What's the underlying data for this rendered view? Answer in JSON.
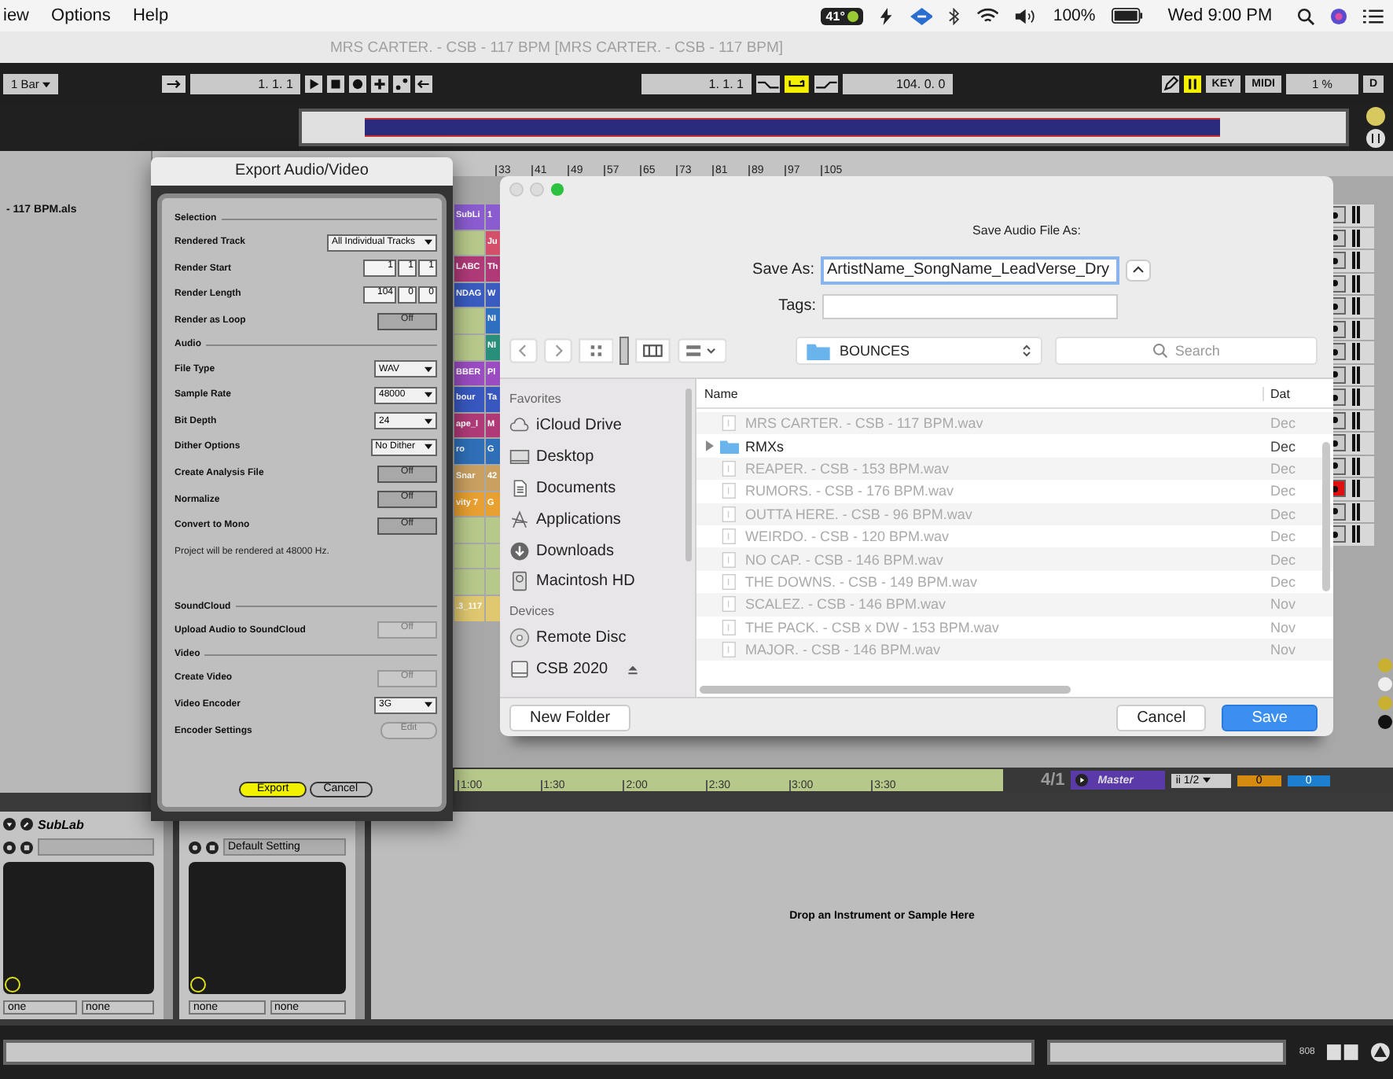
{
  "menu_bar": {
    "items": [
      "iew",
      "Options",
      "Help"
    ],
    "temperature": "41°",
    "battery": "100%",
    "clock": "Wed 9:00 PM"
  },
  "daw": {
    "title": "MRS CARTER. - CSB - 117 BPM  [MRS CARTER. - CSB - 117 BPM]",
    "quantize": "1 Bar",
    "position": "1.   1.   1",
    "loop_start": "1.   1.   1",
    "loop_switch": {
      "on": true
    },
    "loop_length": "104.   0.   0",
    "key_button": "KEY",
    "midi_button": "MIDI",
    "cpu": "1 %",
    "d_button": "D",
    "ruler": [
      "33",
      "41",
      "49",
      "57",
      "65",
      "73",
      "81",
      "89",
      "97",
      "105"
    ],
    "set_name": "- 117 BPM.als",
    "clip_rows": [
      {
        "clips": [
          {
            "label": "SubLi",
            "color": "#8a5cd0"
          },
          {
            "label": "1",
            "color": "#8a5cd0"
          }
        ]
      },
      {
        "clips": [
          {
            "color": "#b7c98a"
          },
          {
            "label": "Ju",
            "color": "#d4506a"
          }
        ]
      },
      {
        "clips": [
          {
            "label": "LABC",
            "color": "#b03a78"
          },
          {
            "label": "Th",
            "color": "#b03a78"
          }
        ]
      },
      {
        "clips": [
          {
            "label": "NDAG",
            "color": "#3a5cc0"
          },
          {
            "label": "W",
            "color": "#3a5cc0"
          }
        ]
      },
      {
        "clips": [
          {
            "color": "#b7c98a"
          },
          {
            "label": "NI",
            "color": "#2f6fc0"
          }
        ]
      },
      {
        "clips": [
          {
            "color": "#b7c98a"
          },
          {
            "label": "NI",
            "color": "#2a8f7a"
          }
        ]
      },
      {
        "clips": [
          {
            "label": "BBER",
            "color": "#9a4cc0"
          },
          {
            "label": "Pl",
            "color": "#9a4cc0"
          }
        ]
      },
      {
        "clips": [
          {
            "label": "bour",
            "color": "#3858c0"
          },
          {
            "label": "Ta",
            "color": "#3858c0"
          }
        ]
      },
      {
        "clips": [
          {
            "label": "ape_l",
            "color": "#b03a78"
          },
          {
            "label": "M",
            "color": "#b03a78"
          }
        ]
      },
      {
        "clips": [
          {
            "label": "ro",
            "color": "#2f6fb8"
          },
          {
            "label": "G",
            "color": "#2f6fb8"
          }
        ]
      },
      {
        "clips": [
          {
            "label": "Snar",
            "color": "#c9a060"
          },
          {
            "label": "42",
            "color": "#c9a060"
          }
        ]
      },
      {
        "clips": [
          {
            "label": "vity 7",
            "color": "#e8a030"
          },
          {
            "label": "G",
            "color": "#e8a030"
          }
        ]
      },
      {
        "clips": [
          {
            "color": "#b7c98a"
          },
          {
            "color": "#b7c98a"
          }
        ]
      },
      {
        "clips": [
          {
            "color": "#b7c98a"
          },
          {
            "color": "#b7c98a"
          }
        ]
      },
      {
        "clips": [
          {
            "color": "#b7c98a"
          },
          {
            "color": "#b7c98a"
          }
        ]
      },
      {
        "clips": [
          {
            "label": ".3_117",
            "color": "#e0c870"
          },
          {
            "color": "#e0c870"
          }
        ]
      }
    ],
    "track_buttons": [
      {
        "armed": false
      },
      {
        "armed": false
      },
      {
        "armed": false
      },
      {
        "armed": false
      },
      {
        "armed": false
      },
      {
        "armed": false
      },
      {
        "armed": false
      },
      {
        "armed": false
      },
      {
        "armed": false
      },
      {
        "armed": false
      },
      {
        "armed": false
      },
      {
        "armed": false
      },
      {
        "armed": true
      },
      {
        "armed": false
      },
      {
        "armed": false
      }
    ],
    "time_ruler": [
      "1:00",
      "1:30",
      "2:00",
      "2:30",
      "3:00",
      "3:30"
    ],
    "master": {
      "position": "4/1",
      "name": "Master",
      "routing": "ii 1/2",
      "volume": "0",
      "pan": "0"
    },
    "devices": [
      {
        "name": "SubLab",
        "selectors": [
          "one",
          "none"
        ]
      },
      {
        "preset": "Default Setting",
        "selectors": [
          "none",
          "none"
        ]
      }
    ],
    "drop_hint": "Drop an Instrument or Sample Here",
    "status": "808"
  },
  "export_dialog": {
    "title": "Export Audio/Video",
    "sections": [
      {
        "title": "Selection",
        "rows": [
          {
            "kind": "dropdown",
            "label": "Rendered Track",
            "value": "All Individual Tracks"
          },
          {
            "kind": "numbers",
            "label": "Render Start",
            "values": [
              "1",
              "1",
              "1"
            ]
          },
          {
            "kind": "numbers",
            "label": "Render Length",
            "values": [
              "104",
              "0",
              "0"
            ]
          },
          {
            "kind": "toggle",
            "label": "Render as Loop",
            "value": "Off",
            "disabled": false
          }
        ]
      },
      {
        "title": "Audio",
        "rows": [
          {
            "kind": "dropdown",
            "label": "File Type",
            "value": "WAV"
          },
          {
            "kind": "dropdown",
            "label": "Sample Rate",
            "value": "48000"
          },
          {
            "kind": "dropdown",
            "label": "Bit Depth",
            "value": "24"
          },
          {
            "kind": "dropdown",
            "label": "Dither Options",
            "value": "No Dither"
          },
          {
            "kind": "toggle",
            "label": "Create Analysis File",
            "value": "Off",
            "disabled": false
          },
          {
            "kind": "toggle",
            "label": "Normalize",
            "value": "Off",
            "disabled": false
          },
          {
            "kind": "toggle",
            "label": "Convert to Mono",
            "value": "Off",
            "disabled": false
          },
          {
            "kind": "note",
            "text": "Project will be rendered at 48000 Hz."
          }
        ]
      },
      {
        "title": "SoundCloud",
        "rows": [
          {
            "kind": "toggle",
            "label": "Upload Audio to SoundCloud",
            "value": "Off",
            "disabled": true
          }
        ]
      },
      {
        "title": "Video",
        "rows": [
          {
            "kind": "toggle",
            "label": "Create Video",
            "value": "Off",
            "disabled": true
          },
          {
            "kind": "dropdown",
            "label": "Video Encoder",
            "value": "3G"
          },
          {
            "kind": "button",
            "label": "Encoder Settings",
            "value": "Edit",
            "disabled": true
          }
        ]
      }
    ],
    "buttons": [
      {
        "label": "Export",
        "primary": true
      },
      {
        "label": "Cancel",
        "primary": false
      }
    ]
  },
  "save_dialog": {
    "heading": "Save Audio File As:",
    "save_as_label": "Save As:",
    "filename": "ArtistName_SongName_LeadVerse_Dry",
    "tags_label": "Tags:",
    "location": "BOUNCES",
    "search": {
      "placeholder": "Search"
    },
    "sidebar": [
      {
        "title": "Favorites",
        "items": [
          {
            "label": "iCloud Drive",
            "kind": "cloud"
          },
          {
            "label": "Desktop",
            "kind": "desktop"
          },
          {
            "label": "Documents",
            "kind": "documents"
          },
          {
            "label": "Applications",
            "kind": "applications"
          },
          {
            "label": "Downloads",
            "kind": "downloads"
          },
          {
            "label": "Macintosh HD",
            "kind": "disk"
          }
        ]
      },
      {
        "title": "Devices",
        "items": [
          {
            "label": "Remote Disc",
            "kind": "disc"
          },
          {
            "label": "CSB 2020",
            "kind": "drive",
            "eject": true
          }
        ]
      }
    ],
    "columns": [
      "Name",
      "Dat"
    ],
    "files": [
      {
        "name": "MRS CARTER. - CSB - 117 BPM.wav",
        "kind": "file",
        "enabled": false,
        "date": "Dec"
      },
      {
        "name": "RMXs",
        "kind": "folder",
        "enabled": true,
        "date": "Dec"
      },
      {
        "name": "REAPER. - CSB - 153 BPM.wav",
        "kind": "file",
        "enabled": false,
        "date": "Dec"
      },
      {
        "name": "RUMORS. - CSB - 176 BPM.wav",
        "kind": "file",
        "enabled": false,
        "date": "Dec"
      },
      {
        "name": "OUTTA HERE. - CSB - 96 BPM.wav",
        "kind": "file",
        "enabled": false,
        "date": "Dec"
      },
      {
        "name": "WEIRDO. - CSB - 120 BPM.wav",
        "kind": "file",
        "enabled": false,
        "date": "Dec"
      },
      {
        "name": "NO CAP. - CSB - 146 BPM.wav",
        "kind": "file",
        "enabled": false,
        "date": "Dec"
      },
      {
        "name": "THE DOWNS. - CSB - 149 BPM.wav",
        "kind": "file",
        "enabled": false,
        "date": "Dec"
      },
      {
        "name": "SCALEZ. - CSB - 146 BPM.wav",
        "kind": "file",
        "enabled": false,
        "date": "Nov"
      },
      {
        "name": "THE PACK. - CSB x DW - 153 BPM.wav",
        "kind": "file",
        "enabled": false,
        "date": "Nov"
      },
      {
        "name": "MAJOR. - CSB - 146 BPM.wav",
        "kind": "file",
        "enabled": false,
        "date": "Nov"
      }
    ],
    "buttons": [
      {
        "label": "New Folder",
        "kind": "left"
      },
      {
        "label": "Cancel",
        "kind": "cancel"
      },
      {
        "label": "Save",
        "kind": "default"
      }
    ]
  }
}
